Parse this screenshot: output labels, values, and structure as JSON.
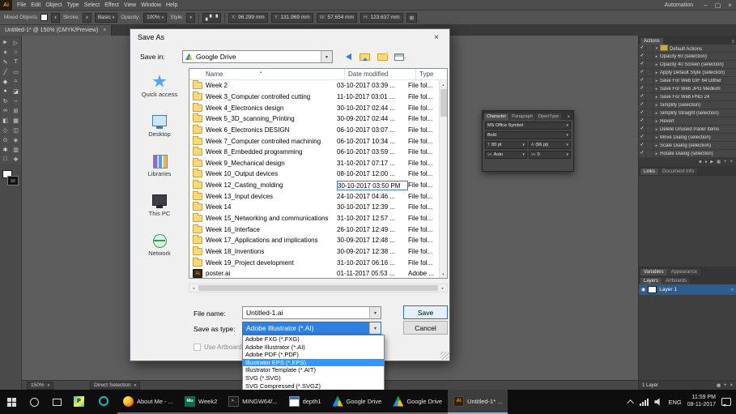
{
  "colors": {
    "accent_blue": "#0078d7",
    "selection_blue": "#3297fd",
    "folder_yellow": "#f9d978",
    "illustrator_orange": "#ff9a00",
    "taskbar_black": "#0e0e0e",
    "chrome_gray": "#535353"
  },
  "menubar": {
    "logo": "Ai",
    "items": [
      "File",
      "Edit",
      "Object",
      "Type",
      "Select",
      "Effect",
      "View",
      "Window",
      "Help"
    ],
    "workspace": "Automation",
    "window_buttons": [
      "–",
      "▢",
      "×"
    ]
  },
  "optionsbar": {
    "context_label": "Mixed Objects",
    "stroke_label": "Stroke:",
    "brush_value": "Basic",
    "opacity_label": "Opacity:",
    "opacity_value": "100%",
    "style_label": "Style:",
    "transform_fields": [
      {
        "label": "X:",
        "value": "96.299 mm"
      },
      {
        "label": "Y:",
        "value": "131.969 mm"
      },
      {
        "label": "W:",
        "value": "57.654 mm"
      },
      {
        "label": "H:",
        "value": "123.637 mm"
      }
    ]
  },
  "document_tab": {
    "title": "Untitled-1* @ 150% (CMYK/Preview)",
    "close": "×"
  },
  "toolbar": {
    "tools": [
      {
        "name": "selection-tool",
        "glyph": "►"
      },
      {
        "name": "direct-selection-tool",
        "glyph": "▷"
      },
      {
        "name": "magic-wand-tool",
        "glyph": "✶"
      },
      {
        "name": "lasso-tool",
        "glyph": "○"
      },
      {
        "name": "pen-tool",
        "glyph": "✎"
      },
      {
        "name": "type-tool",
        "glyph": "T"
      },
      {
        "name": "line-segment-tool",
        "glyph": "╱"
      },
      {
        "name": "rectangle-tool",
        "glyph": "▭"
      },
      {
        "name": "paintbrush-tool",
        "glyph": "◆"
      },
      {
        "name": "pencil-tool",
        "glyph": "≈"
      },
      {
        "name": "blob-brush-tool",
        "glyph": "●"
      },
      {
        "name": "eraser-tool",
        "glyph": "◪"
      },
      {
        "name": "rotate-tool",
        "glyph": "↻"
      },
      {
        "name": "scale-tool",
        "glyph": "↔"
      },
      {
        "name": "width-tool",
        "glyph": "∞"
      },
      {
        "name": "free-transform-tool",
        "glyph": "⊞"
      },
      {
        "name": "shape-builder-tool",
        "glyph": "◧"
      },
      {
        "name": "perspective-grid-tool",
        "glyph": "▦"
      },
      {
        "name": "mesh-tool",
        "glyph": "◇"
      },
      {
        "name": "gradient-tool",
        "glyph": "◫"
      },
      {
        "name": "eyedropper-tool",
        "glyph": "⊙"
      },
      {
        "name": "blend-tool",
        "glyph": "◈"
      },
      {
        "name": "symbol-sprayer-tool",
        "glyph": "✱"
      },
      {
        "name": "column-graph-tool",
        "glyph": "▥"
      },
      {
        "name": "artboard-tool",
        "glyph": "□"
      },
      {
        "name": "hand-tool",
        "glyph": "❖"
      }
    ]
  },
  "statusbar": {
    "zoom": "150%",
    "tool": "Direct Selection"
  },
  "character_panel": {
    "tabs": [
      {
        "label": "Character",
        "active": true
      },
      {
        "label": "Paragraph"
      },
      {
        "label": "OpenType"
      }
    ],
    "close": "×",
    "font": "MS Office Symbol",
    "style": "Bold",
    "size": "80 pt",
    "leading": "(96 pt)",
    "kerning": "Auto",
    "tracking": "0"
  },
  "right_dock": {
    "actions": {
      "title": "Actions",
      "rows": [
        {
          "label": "Default Actions",
          "checked": true,
          "set": true
        },
        {
          "label": "Opacity 60 (selection)",
          "checked": true
        },
        {
          "label": "Opacity 40 Screen (selection)",
          "checked": true
        },
        {
          "label": "Apply Default Style (selection)",
          "checked": true
        },
        {
          "label": "Save For Web GIF 64 Dither",
          "checked": true
        },
        {
          "label": "Save For Web JPG Medium",
          "checked": true
        },
        {
          "label": "Save For Web PNG 24",
          "checked": true
        },
        {
          "label": "Simplify (selection)",
          "checked": true
        },
        {
          "label": "Simplify Straight (selection)",
          "checked": true
        },
        {
          "label": "Revert",
          "checked": true
        },
        {
          "label": "Delete Unused Panel Items",
          "checked": true
        },
        {
          "label": "Move Dialog (selection)",
          "checked": true
        },
        {
          "label": "Scale Dialog (selection)",
          "checked": true
        },
        {
          "label": "Rotate Dialog (selection)",
          "checked": true
        }
      ]
    },
    "links_tabs": [
      "Links",
      "Document Info"
    ],
    "mid_tabs": [
      "Variables",
      "Appearance"
    ],
    "layers_tabs": [
      "Layers",
      "Artboards"
    ],
    "layer_name": "Layer 1",
    "layer_count": "1 Layer"
  },
  "dialog": {
    "title": "Save As",
    "close": "×",
    "save_in": {
      "label": "Save in:",
      "value": "Google Drive"
    },
    "icons": [
      "back-icon",
      "up-one-level-icon",
      "new-folder-icon",
      "view-menu-icon"
    ],
    "sidebar": [
      {
        "label": "Quick access",
        "icon": "quick-access",
        "name": "sidebar-quick-access",
        "icon_name": "quick-access-icon"
      },
      {
        "label": "Desktop",
        "icon": "desktop",
        "name": "sidebar-desktop",
        "icon_name": "desktop-icon"
      },
      {
        "label": "Libraries",
        "icon": "libraries",
        "name": "sidebar-libraries",
        "icon_name": "libraries-icon"
      },
      {
        "label": "This PC",
        "icon": "this-pc",
        "name": "sidebar-this-pc",
        "icon_name": "this-pc-icon"
      },
      {
        "label": "Network",
        "icon": "network",
        "name": "sidebar-network",
        "icon_name": "network-icon"
      }
    ],
    "list": {
      "columns": [
        "Name",
        "Date modified",
        "Type"
      ],
      "rows": [
        {
          "name": "Week 2",
          "date": "03-10-2017 03:39 ...",
          "type": "File fol..."
        },
        {
          "name": "Week 3_Computer controlled cutting",
          "date": "11-10-2017 03:01 ...",
          "type": "File fol..."
        },
        {
          "name": "Week 4_Electronics design",
          "date": "30-10-2017 02:44 ...",
          "type": "File fol..."
        },
        {
          "name": "Week 5_3D_scanning_Printing",
          "date": "30-09-2017 02:44 ...",
          "type": "File fol..."
        },
        {
          "name": "Week 6_Electronics DESIGN",
          "date": "06-10-2017 03:07 ...",
          "type": "File fol..."
        },
        {
          "name": "Week 7_Computer controlled machining",
          "date": "06-10-2017 10:34 ...",
          "type": "File fol..."
        },
        {
          "name": "Week 8_Embedded programming",
          "date": "06-10-2017 03:59 ...",
          "type": "File fol..."
        },
        {
          "name": "Week 9_Mechanical design",
          "date": "31-10-2017 07:17 ...",
          "type": "File fol..."
        },
        {
          "name": "Week 10_Output devices",
          "date": "08-10-2017 12:00 ...",
          "type": "File fol..."
        },
        {
          "name": "Week 12_Casting_molding",
          "date": "30-10-2017 03:50 PM",
          "type": "File fol...",
          "date_boxed": true
        },
        {
          "name": "Week 13_Input devices",
          "date": "24-10-2017 04:46 ...",
          "type": "File fol..."
        },
        {
          "name": "Week 14",
          "date": "30-10-2017 12:39 ...",
          "type": "File fol..."
        },
        {
          "name": "Week 15_Networking and communications",
          "date": "31-10-2017 12:57 ...",
          "type": "File fol..."
        },
        {
          "name": "Week 16_Interface",
          "date": "26-10-2017 12:49 ...",
          "type": "File fol..."
        },
        {
          "name": "Week 17_Applications and implications",
          "date": "30-09-2017 12:48 ...",
          "type": "File fol..."
        },
        {
          "name": "Week 18_Inventions",
          "date": "30-09-2017 12:38 ...",
          "type": "File fol..."
        },
        {
          "name": "Week 19_Project development",
          "date": "31-10-2017 06:16 ...",
          "type": "File fol..."
        },
        {
          "name": "poster.ai",
          "date": "01-11-2017 05:53 ...",
          "type": "Adobe ...",
          "ai": true
        }
      ]
    },
    "file_name": {
      "label": "File name:",
      "value": "Untitled-1.ai"
    },
    "save_as_type": {
      "label": "Save as type:",
      "value": "Adobe Illustrator (*.AI)"
    },
    "type_options": [
      {
        "label": "Adobe FXG (*.FXG)"
      },
      {
        "label": "Adobe Illustrator (*.AI)"
      },
      {
        "label": "Adobe PDF (*.PDF)"
      },
      {
        "label": "Illustrator EPS (*.EPS)",
        "selected": true
      },
      {
        "label": "Illustrator Template (*.AIT)"
      },
      {
        "label": "SVG (*.SVG)"
      },
      {
        "label": "SVG Compressed (*.SVGZ)"
      }
    ],
    "buttons": {
      "save": "Save",
      "cancel": "Cancel"
    },
    "use_artboards": "Use Artboards"
  },
  "taskbar": {
    "apps": [
      {
        "name": "taskbar-app-pycharm",
        "icon": "pycharm",
        "label": ""
      },
      {
        "name": "taskbar-app-teal",
        "icon": "teal",
        "label": ""
      },
      {
        "name": "taskbar-app-firefox",
        "icon": "firefox",
        "label": "About Me - ...",
        "labeled": true
      },
      {
        "name": "taskbar-app-mu",
        "icon": "mu",
        "label": "Week2",
        "labeled": true
      },
      {
        "name": "taskbar-app-terminal",
        "icon": "terminal",
        "label": "MINGW64/...",
        "labeled": true
      },
      {
        "name": "taskbar-app-depth1",
        "icon": "window",
        "label": "depth1",
        "labeled": true
      },
      {
        "name": "taskbar-app-gdrive-1",
        "icon": "gdrive",
        "label": "Google Drive",
        "labeled": true
      },
      {
        "name": "taskbar-app-gdrive-2",
        "icon": "gdrive",
        "label": "Google Drive",
        "labeled": true
      },
      {
        "name": "taskbar-app-illustrator",
        "icon": "ai",
        "label": "Untitled-1* ...",
        "labeled": true,
        "active": true
      }
    ],
    "tray": {
      "language": "ENG",
      "time": "11:59 PM",
      "date": "08-11-2017"
    }
  }
}
